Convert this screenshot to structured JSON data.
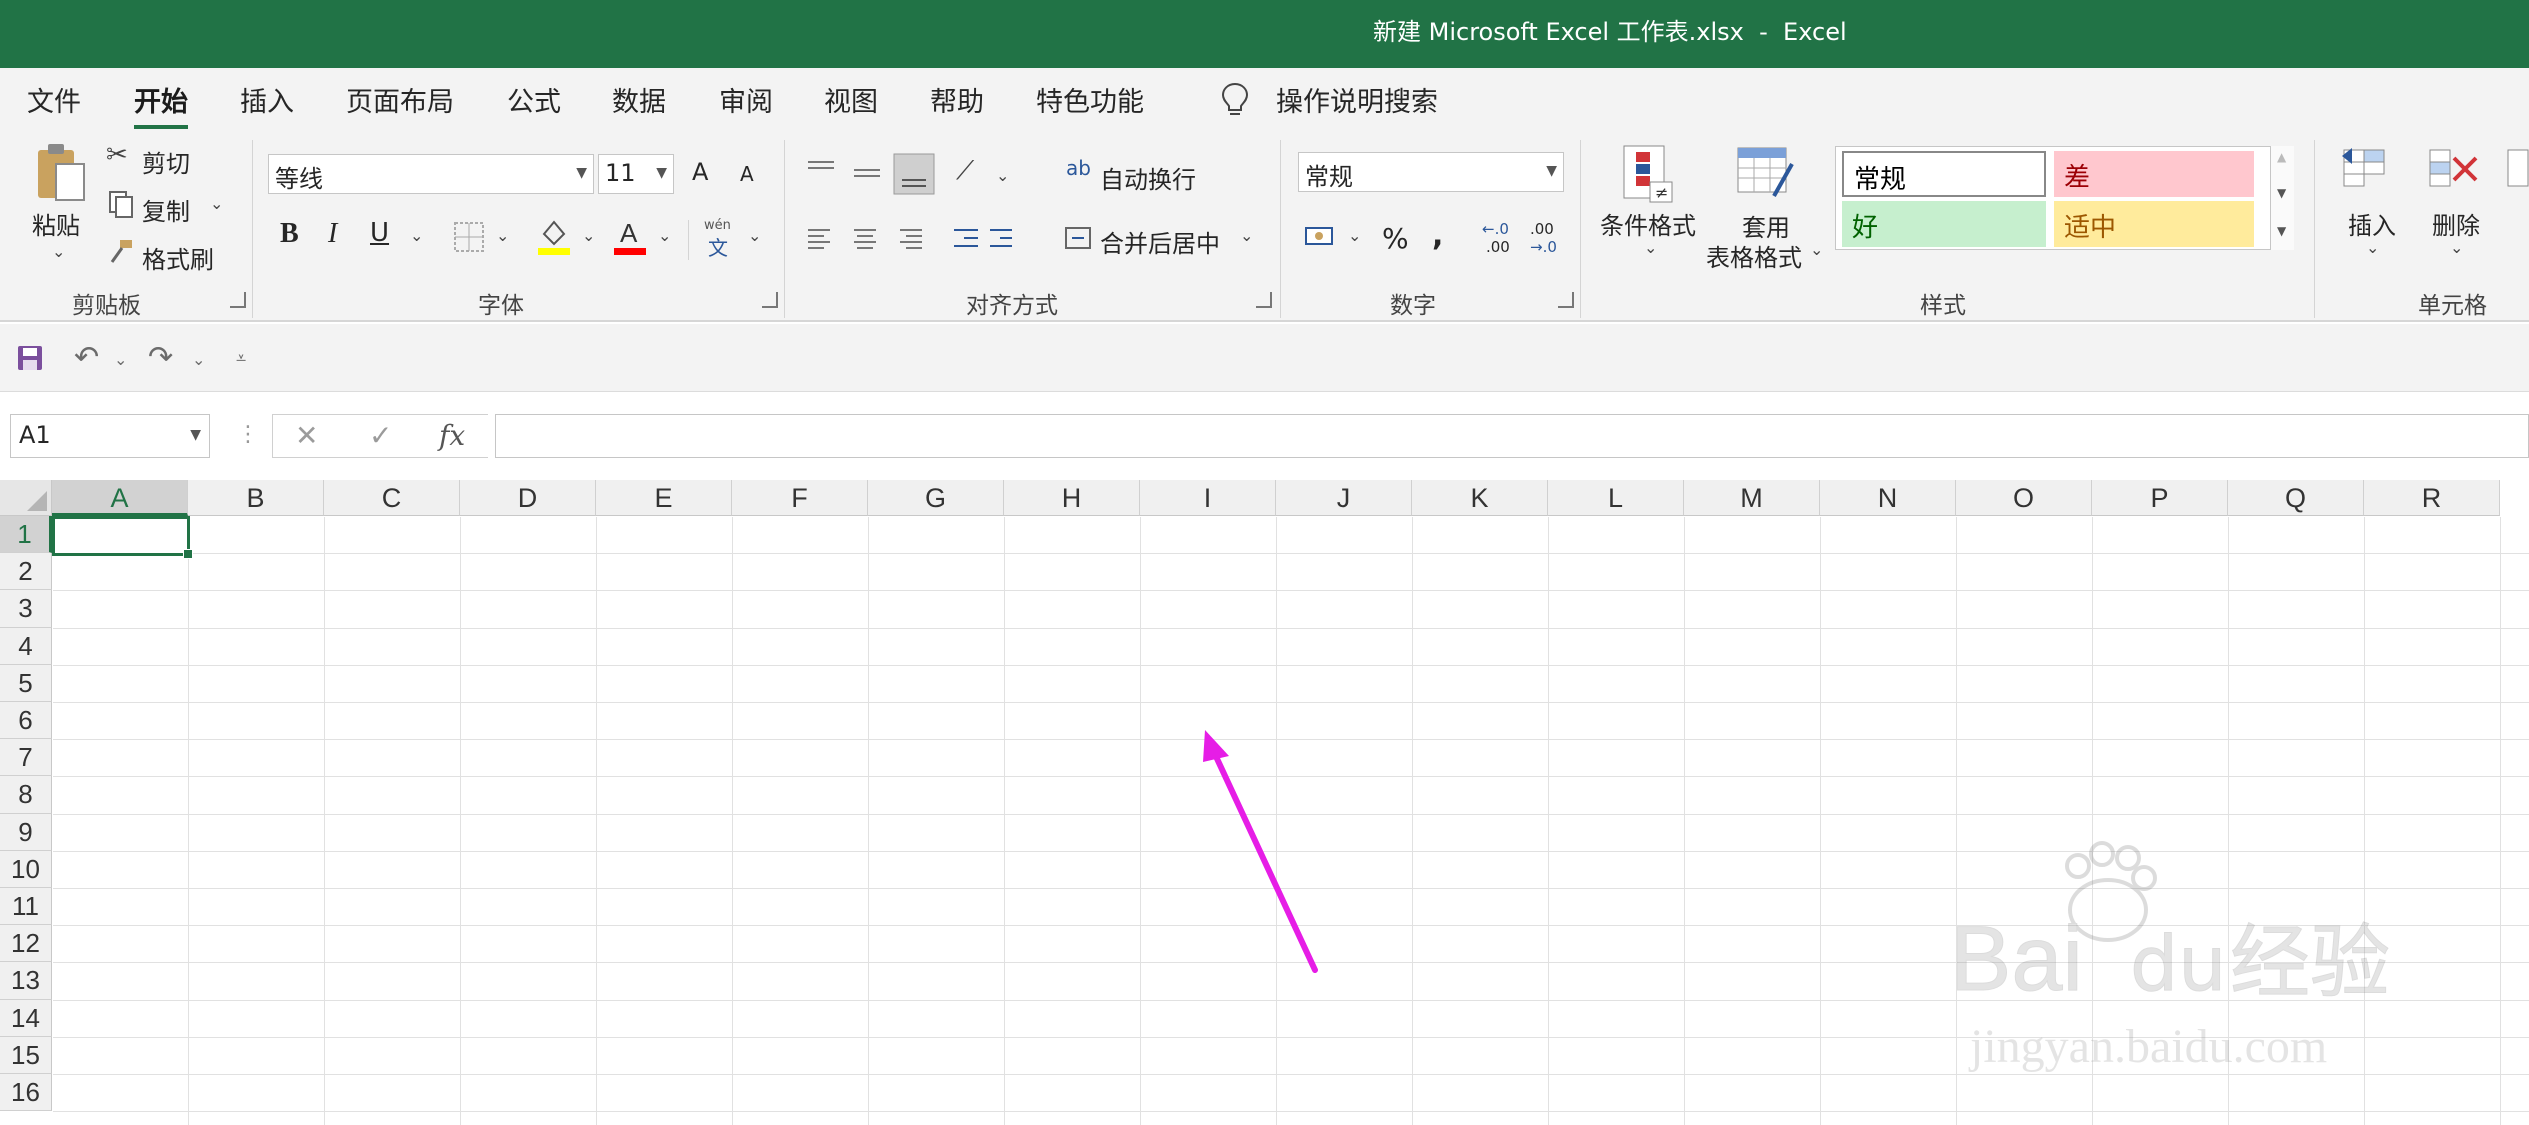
{
  "window": {
    "title": "新建 Microsoft Excel 工作表.xlsx  -  Excel"
  },
  "tabs": [
    "文件",
    "开始",
    "插入",
    "页面布局",
    "公式",
    "数据",
    "审阅",
    "视图",
    "帮助",
    "特色功能"
  ],
  "active_tab": "开始",
  "tell_me": "操作说明搜索",
  "clipboard": {
    "paste": "粘贴",
    "cut": "剪切",
    "copy": "复制",
    "format_painter": "格式刷",
    "group": "剪贴板"
  },
  "font": {
    "name": "等线",
    "size": "11",
    "grow": "A",
    "shrink": "A",
    "bold": "B",
    "italic": "I",
    "underline": "U",
    "phonetic_top": "wén",
    "phonetic_bottom": "文",
    "group": "字体"
  },
  "alignment": {
    "wrap": "自动换行",
    "merge": "合并后居中",
    "group": "对齐方式"
  },
  "number": {
    "format": "常规",
    "percent": "%",
    "comma": ",",
    "inc_decimal_a": "←.0",
    "inc_decimal_b": ".00",
    "dec_decimal_a": ".00",
    "dec_decimal_b": "→.0",
    "group": "数字"
  },
  "styles": {
    "conditional": "条件格式",
    "table_line1": "套用",
    "table_line2": "表格格式",
    "normal": "常规",
    "bad": "差",
    "good": "好",
    "neutral": "适中",
    "group": "样式"
  },
  "cells": {
    "insert": "插入",
    "delete": "删除",
    "group": "单元格"
  },
  "namebox": "A1",
  "formula_buttons": {
    "cancel": "✕",
    "enter": "✓",
    "fx": "fx"
  },
  "columns": [
    "A",
    "B",
    "C",
    "D",
    "E",
    "F",
    "G",
    "H",
    "I",
    "J",
    "K",
    "L",
    "M",
    "N",
    "O",
    "P",
    "Q",
    "R"
  ],
  "rows": [
    "1",
    "2",
    "3",
    "4",
    "5",
    "6",
    "7",
    "8",
    "9",
    "10",
    "11",
    "12",
    "13",
    "14",
    "15",
    "16"
  ],
  "selected_cell": "A1",
  "watermark": {
    "brand": "Bai",
    "brand2": "经验",
    "url": "jingyan.baidu.com"
  },
  "colors": {
    "accent": "#217346",
    "arrow": "#e61de6",
    "bad_bg": "#ffc7ce",
    "good_bg": "#c6efce",
    "neutral_bg": "#ffeb9c"
  }
}
